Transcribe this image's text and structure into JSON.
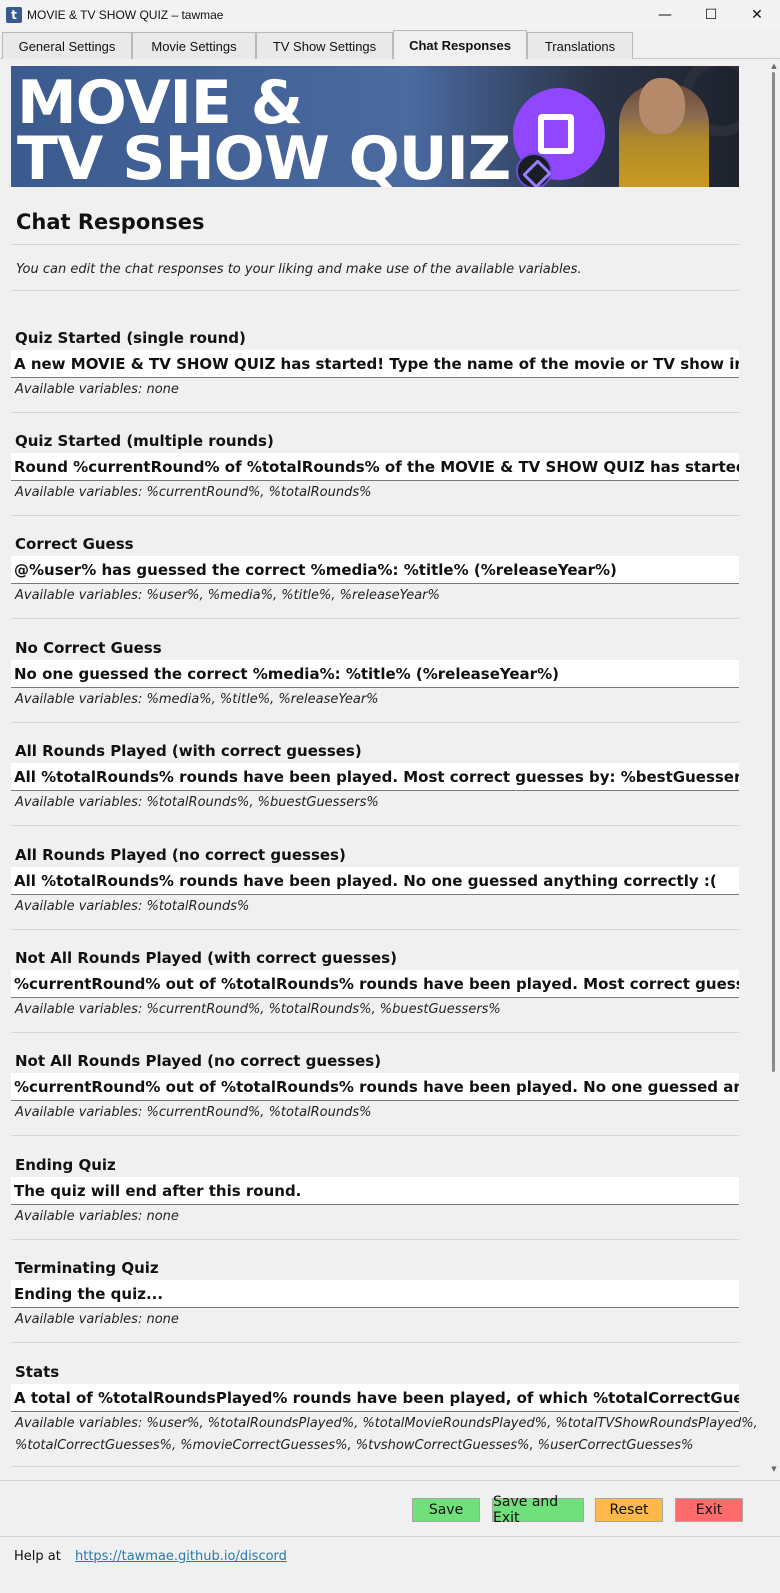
{
  "window": {
    "title": "MOVIE & TV SHOW QUIZ – tawmae",
    "app_icon_letter": "t",
    "minimize": "—",
    "maximize": "☐",
    "close": "✕"
  },
  "tabs": [
    {
      "label": "General Settings",
      "active": false
    },
    {
      "label": "Movie Settings",
      "active": false
    },
    {
      "label": "TV Show Settings",
      "active": false
    },
    {
      "label": "Chat Responses",
      "active": true
    },
    {
      "label": "Translations",
      "active": false
    }
  ],
  "banner": {
    "line1": "MOVIE &",
    "line2": "TV SHOW QUIZ"
  },
  "page": {
    "heading": "Chat Responses",
    "intro": "You can edit the chat responses to your liking and make use of the available variables."
  },
  "sections": [
    {
      "title": "Quiz Started (single round)",
      "value": "A new MOVIE & TV SHOW QUIZ has started! Type the name of the movie or TV show into the cha",
      "vars": "Available variables: none"
    },
    {
      "title": "Quiz Started (multiple rounds)",
      "value": "Round %currentRound% of %totalRounds% of the MOVIE & TV SHOW QUIZ has started. Type the",
      "vars": "Available variables: %currentRound%, %totalRounds%"
    },
    {
      "title": "Correct Guess",
      "value": "@%user% has guessed the correct %media%: %title% (%releaseYear%)",
      "vars": "Available variables: %user%, %media%, %title%, %releaseYear%"
    },
    {
      "title": "No Correct Guess",
      "value": "No one guessed the correct %media%: %title% (%releaseYear%)",
      "vars": "Available variables: %media%, %title%, %releaseYear%"
    },
    {
      "title": "All Rounds Played (with correct guesses)",
      "value": "All %totalRounds% rounds have been played. Most correct guesses by: %bestGuessers%",
      "vars": "Available variables: %totalRounds%, %buestGuessers%"
    },
    {
      "title": "All Rounds Played (no correct guesses)",
      "value": "All %totalRounds% rounds have been played. No one guessed anything correctly :(",
      "vars": "Available variables: %totalRounds%"
    },
    {
      "title": "Not All Rounds Played (with correct guesses)",
      "value": "%currentRound% out of %totalRounds% rounds have been played. Most correct guesses by: %be",
      "vars": "Available variables: %currentRound%, %totalRounds%, %buestGuessers%"
    },
    {
      "title": "Not All Rounds Played (no correct guesses)",
      "value": "%currentRound% out of %totalRounds% rounds have been played. No one guessed anything cor",
      "vars": "Available variables:  %currentRound%, %totalRounds%"
    },
    {
      "title": "Ending Quiz",
      "value": "The quiz will end after this round.",
      "vars": "Available variables: none"
    },
    {
      "title": "Terminating Quiz",
      "value": "Ending the quiz...",
      "vars": "Available variables: none"
    },
    {
      "title": "Stats",
      "value": "A total of %totalRoundsPlayed% rounds have been played, of which %totalCorrectGuesses% hav",
      "vars": "Available variables: %user%, %totalRoundsPlayed%, %totalMovieRoundsPlayed%, %totalTVShowRoundsPlayed%,",
      "vars2": "%totalCorrectGuesses%, %movieCorrectGuesses%, %tvshowCorrectGuesses%, %userCorrectGuesses%"
    }
  ],
  "buttons": {
    "save": "Save",
    "save_exit": "Save and Exit",
    "reset": "Reset",
    "exit": "Exit"
  },
  "help": {
    "label": "Help at",
    "link": "https://tawmae.github.io/discord"
  },
  "colors": {
    "save": "#6fe07a",
    "reset": "#ffb84a",
    "exit": "#ff6b6b",
    "link": "#2a7aa8",
    "twitch": "#9146ff"
  }
}
